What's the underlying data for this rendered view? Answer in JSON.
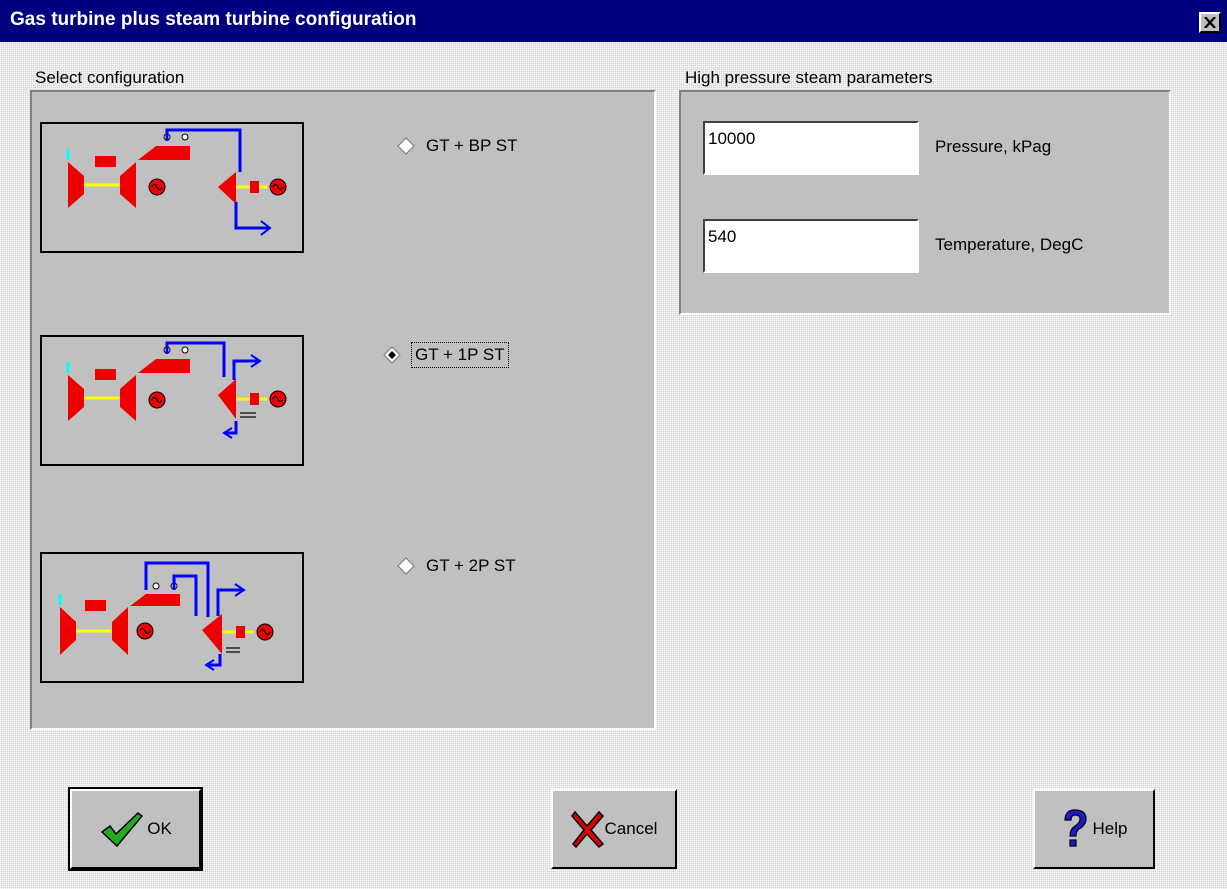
{
  "window": {
    "title": "Gas turbine plus steam turbine configuration",
    "close_icon": "close-icon"
  },
  "config_group": {
    "label": "Select configuration",
    "options": [
      {
        "label": "GT + BP ST",
        "selected": false,
        "diagram": "gt-bp-st-diagram"
      },
      {
        "label": "GT + 1P ST",
        "selected": true,
        "diagram": "gt-1p-st-diagram"
      },
      {
        "label": "GT + 2P ST",
        "selected": false,
        "diagram": "gt-2p-st-diagram"
      }
    ]
  },
  "steam_group": {
    "label": "High pressure steam parameters",
    "pressure": {
      "value": "10000",
      "label": "Pressure, kPag"
    },
    "temperature": {
      "value": "540",
      "label": "Temperature, DegC"
    }
  },
  "buttons": {
    "ok": {
      "label": "OK",
      "icon": "checkmark-icon"
    },
    "cancel": {
      "label": "Cancel",
      "icon": "x-icon"
    },
    "help": {
      "label": "Help",
      "icon": "question-mark-icon"
    }
  },
  "colors": {
    "titlebar": "#000080",
    "turbine": "#ee0000",
    "steam_line": "#0000ff",
    "shaft": "#ffff00",
    "inlet": "#00ffff"
  }
}
